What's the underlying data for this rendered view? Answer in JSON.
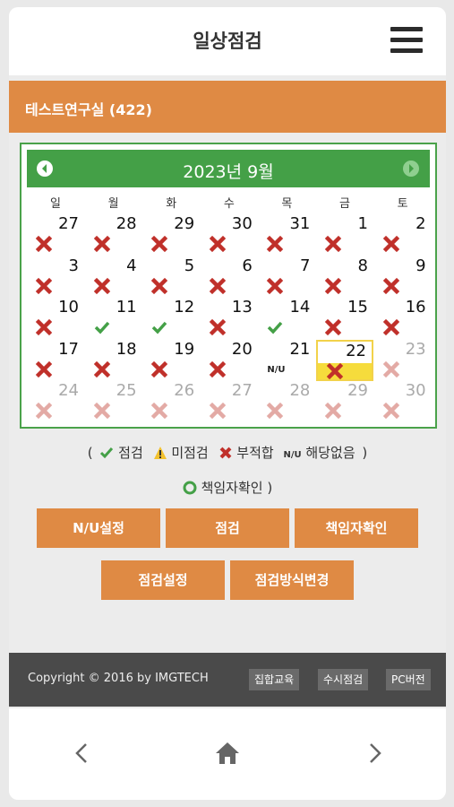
{
  "header": {
    "title": "일상점검",
    "menu_icon": "hamburger-menu-icon"
  },
  "lab": {
    "name": "테스트연구실 (422)"
  },
  "calendar": {
    "month_label": "2023년 9월",
    "weekdays": [
      "일",
      "월",
      "화",
      "수",
      "목",
      "금",
      "토"
    ],
    "days": [
      {
        "n": "27",
        "s": "x"
      },
      {
        "n": "28",
        "s": "x"
      },
      {
        "n": "29",
        "s": "x"
      },
      {
        "n": "30",
        "s": "x"
      },
      {
        "n": "31",
        "s": "x"
      },
      {
        "n": "1",
        "s": "x"
      },
      {
        "n": "2",
        "s": "x"
      },
      {
        "n": "3",
        "s": "x"
      },
      {
        "n": "4",
        "s": "x"
      },
      {
        "n": "5",
        "s": "x"
      },
      {
        "n": "6",
        "s": "x"
      },
      {
        "n": "7",
        "s": "x"
      },
      {
        "n": "8",
        "s": "x"
      },
      {
        "n": "9",
        "s": "x"
      },
      {
        "n": "10",
        "s": "x"
      },
      {
        "n": "11",
        "s": "check"
      },
      {
        "n": "12",
        "s": "check"
      },
      {
        "n": "13",
        "s": "x"
      },
      {
        "n": "14",
        "s": "check"
      },
      {
        "n": "15",
        "s": "x"
      },
      {
        "n": "16",
        "s": "x"
      },
      {
        "n": "17",
        "s": "x"
      },
      {
        "n": "18",
        "s": "x"
      },
      {
        "n": "19",
        "s": "x"
      },
      {
        "n": "20",
        "s": "x"
      },
      {
        "n": "21",
        "s": "nu"
      },
      {
        "n": "22",
        "s": "x",
        "today": true
      },
      {
        "n": "23",
        "s": "x-faded",
        "faded": true
      },
      {
        "n": "24",
        "s": "x-faded",
        "faded": true
      },
      {
        "n": "25",
        "s": "x-faded",
        "faded": true
      },
      {
        "n": "26",
        "s": "x-faded",
        "faded": true
      },
      {
        "n": "27",
        "s": "x-faded",
        "faded": true
      },
      {
        "n": "28",
        "s": "x-faded",
        "faded": true
      },
      {
        "n": "29",
        "s": "x-faded",
        "faded": true
      },
      {
        "n": "30",
        "s": "x-faded",
        "faded": true
      }
    ],
    "nu_label": "N/U"
  },
  "legend": {
    "open": "(",
    "check": "점검",
    "warn": "미점검",
    "x": "부적합",
    "nu_badge": "N/U",
    "nu": "해당없음",
    "close": ")",
    "confirm": "책임자확인",
    "confirm_close": ")"
  },
  "buttons": {
    "nu_setting": "N/U설정",
    "inspect": "점검",
    "manager_confirm": "책임자확인",
    "inspect_setting": "점검설정",
    "method_change": "점검방식변경"
  },
  "footer": {
    "copyright": "Copyright © 2016 by IMGTECH",
    "links": [
      "집합교육",
      "수시점검",
      "PC버전"
    ]
  },
  "colors": {
    "accent": "#df8a44",
    "green": "#44a047",
    "red": "#c0302a",
    "today": "#f6dc3c"
  }
}
